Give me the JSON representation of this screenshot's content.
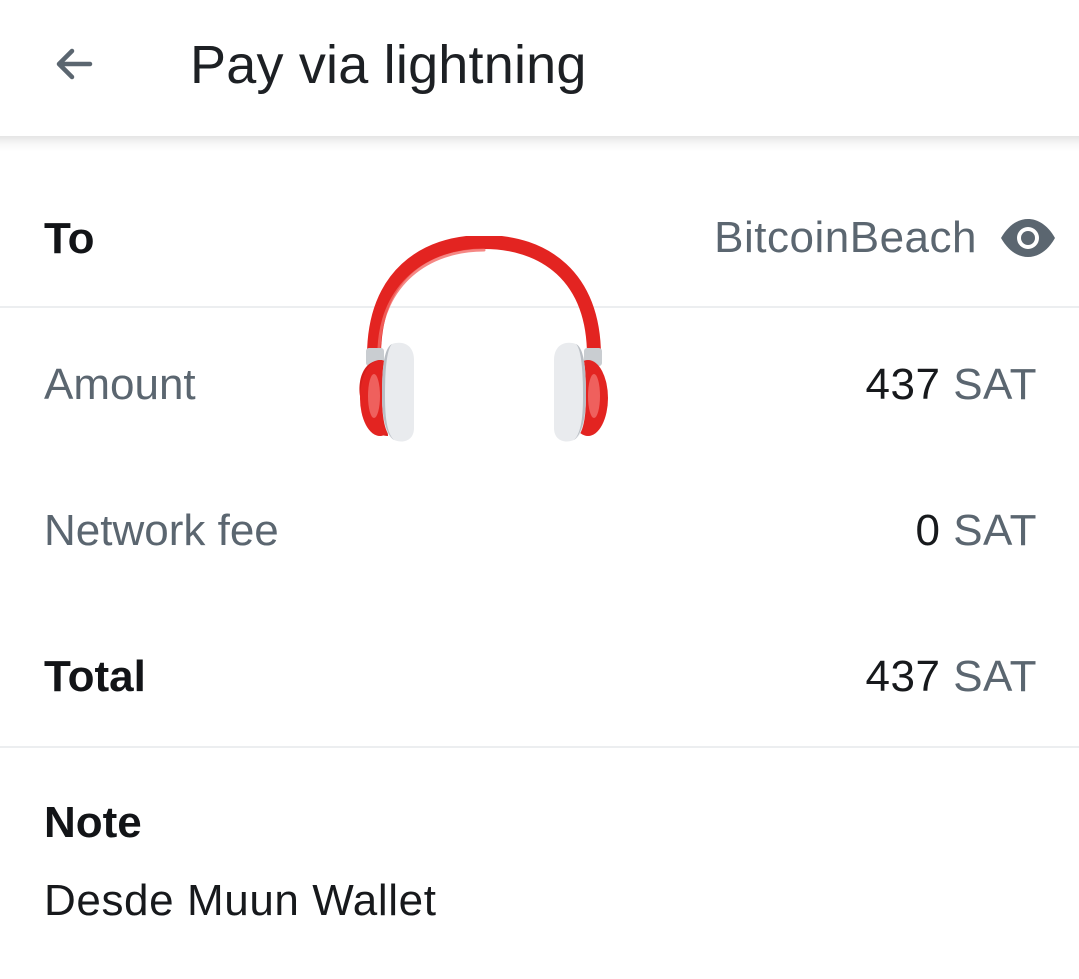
{
  "header": {
    "title": "Pay via lightning",
    "back_icon": "arrow-left-icon"
  },
  "to": {
    "label": "To",
    "recipient": "BitcoinBeach",
    "reveal_icon": "eye-icon"
  },
  "amount": {
    "label": "Amount",
    "value": "437",
    "unit": "SAT"
  },
  "network_fee": {
    "label": "Network fee",
    "value": "0",
    "unit": "SAT"
  },
  "total": {
    "label": "Total",
    "value": "437",
    "unit": "SAT"
  },
  "note": {
    "label": "Note",
    "text": "Desde Muun Wallet"
  },
  "overlay": {
    "icon": "headphones-icon"
  },
  "colors": {
    "text_primary": "#17191c",
    "text_secondary": "#5b6670",
    "icon_gray": "#5b6670",
    "divider": "#eceef0",
    "headphones_red": "#e32421"
  }
}
